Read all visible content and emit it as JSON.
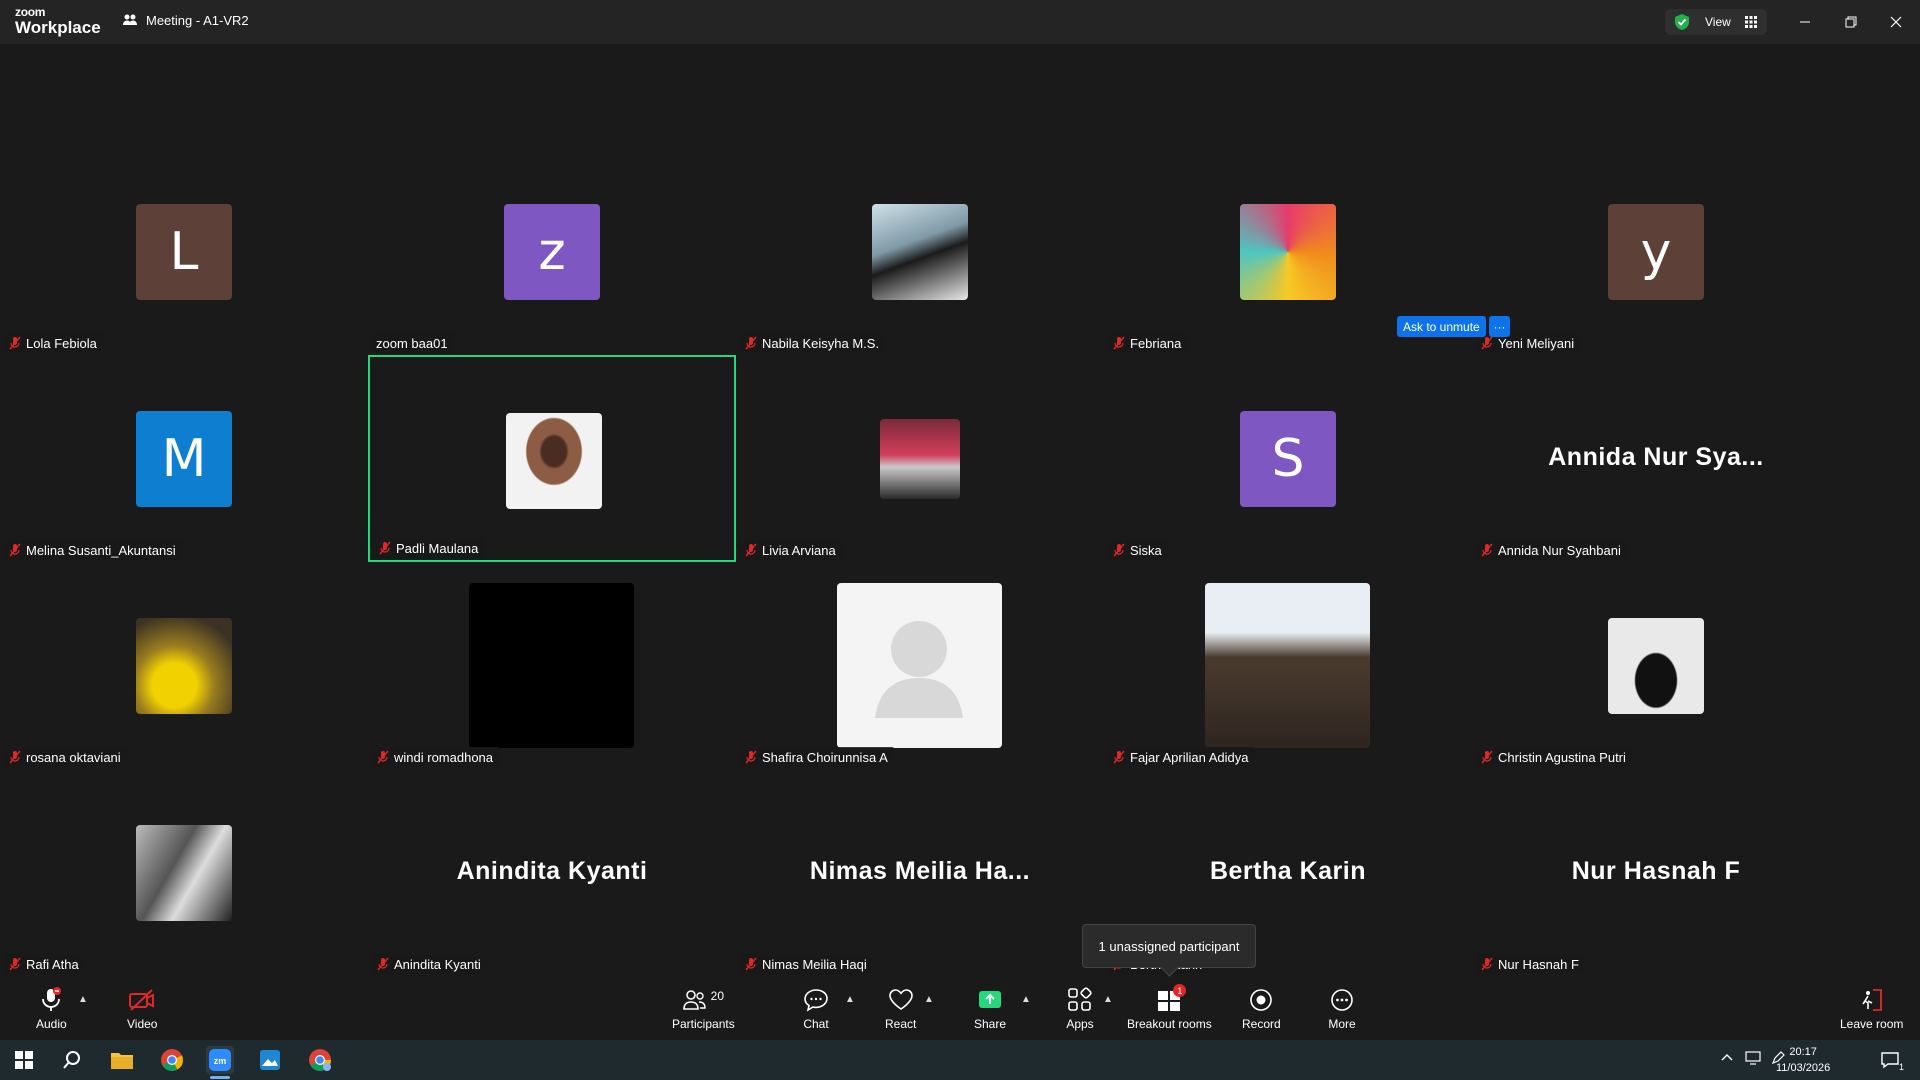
{
  "app": {
    "logo_top": "zoom",
    "logo_bottom": "Workplace",
    "meeting_title": "Meeting - A1-VR2",
    "view_label": "View"
  },
  "tiles": [
    {
      "name": "Lola Febiola",
      "type": "letter",
      "letter": "L",
      "color": "#5d4037"
    },
    {
      "name": "zoom baa01",
      "type": "letter",
      "letter": "z",
      "color": "#7e57c2",
      "unmuted": true
    },
    {
      "name": "Nabila Keisyha M.S.",
      "type": "photo"
    },
    {
      "name": "Febriana",
      "type": "photo"
    },
    {
      "name": "Yeni Meliyani",
      "type": "letter",
      "letter": "y",
      "color": "#5d4037"
    },
    {
      "name": "Melina Susanti_Akuntansi",
      "type": "letter",
      "letter": "M",
      "color": "#0e7fd0"
    },
    {
      "name": "Padli Maulana",
      "type": "photo",
      "active": true
    },
    {
      "name": "Livia Arviana",
      "type": "photo"
    },
    {
      "name": "Siska",
      "type": "letter",
      "letter": "S",
      "color": "#7e57c2"
    },
    {
      "name": "Annida Nur Syahbani",
      "type": "bigname",
      "bigname": "Annida Nur Sya..."
    },
    {
      "name": "rosana oktaviani",
      "type": "photo"
    },
    {
      "name": "windi romadhona",
      "type": "video"
    },
    {
      "name": "Shafira Choirunnisa A",
      "type": "video"
    },
    {
      "name": "Fajar Aprilian Adidya",
      "type": "video"
    },
    {
      "name": "Christin Agustina Putri",
      "type": "photo"
    },
    {
      "name": "Rafi Atha",
      "type": "photo"
    },
    {
      "name": "Anindita Kyanti",
      "type": "bigname",
      "bigname": "Anindita Kyanti"
    },
    {
      "name": "Nimas Meilia Haqi",
      "type": "bigname",
      "bigname": "Nimas Meilia Ha..."
    },
    {
      "name": "Bertha Karin",
      "type": "bigname",
      "bigname": "Bertha Karin"
    },
    {
      "name": "Nur Hasnah F",
      "type": "bigname",
      "bigname": "Nur Hasnah F"
    }
  ],
  "ask_unmute": "Ask to unmute",
  "ask_more": "···",
  "tooltip": "1 unassigned participant",
  "toolbar": {
    "audio": "Audio",
    "video": "Video",
    "participants": "Participants",
    "participants_count": "20",
    "chat": "Chat",
    "react": "React",
    "share": "Share",
    "apps": "Apps",
    "breakout": "Breakout rooms",
    "breakout_badge": "1",
    "record": "Record",
    "more": "More",
    "leave": "Leave room"
  },
  "taskbar": {
    "time": "20:17",
    "date": "11/03/2026",
    "notification_count": "1"
  },
  "colors": {
    "accent_green": "#23d97c",
    "accent_blue": "#0e72ed",
    "muted_red": "#e02828"
  }
}
